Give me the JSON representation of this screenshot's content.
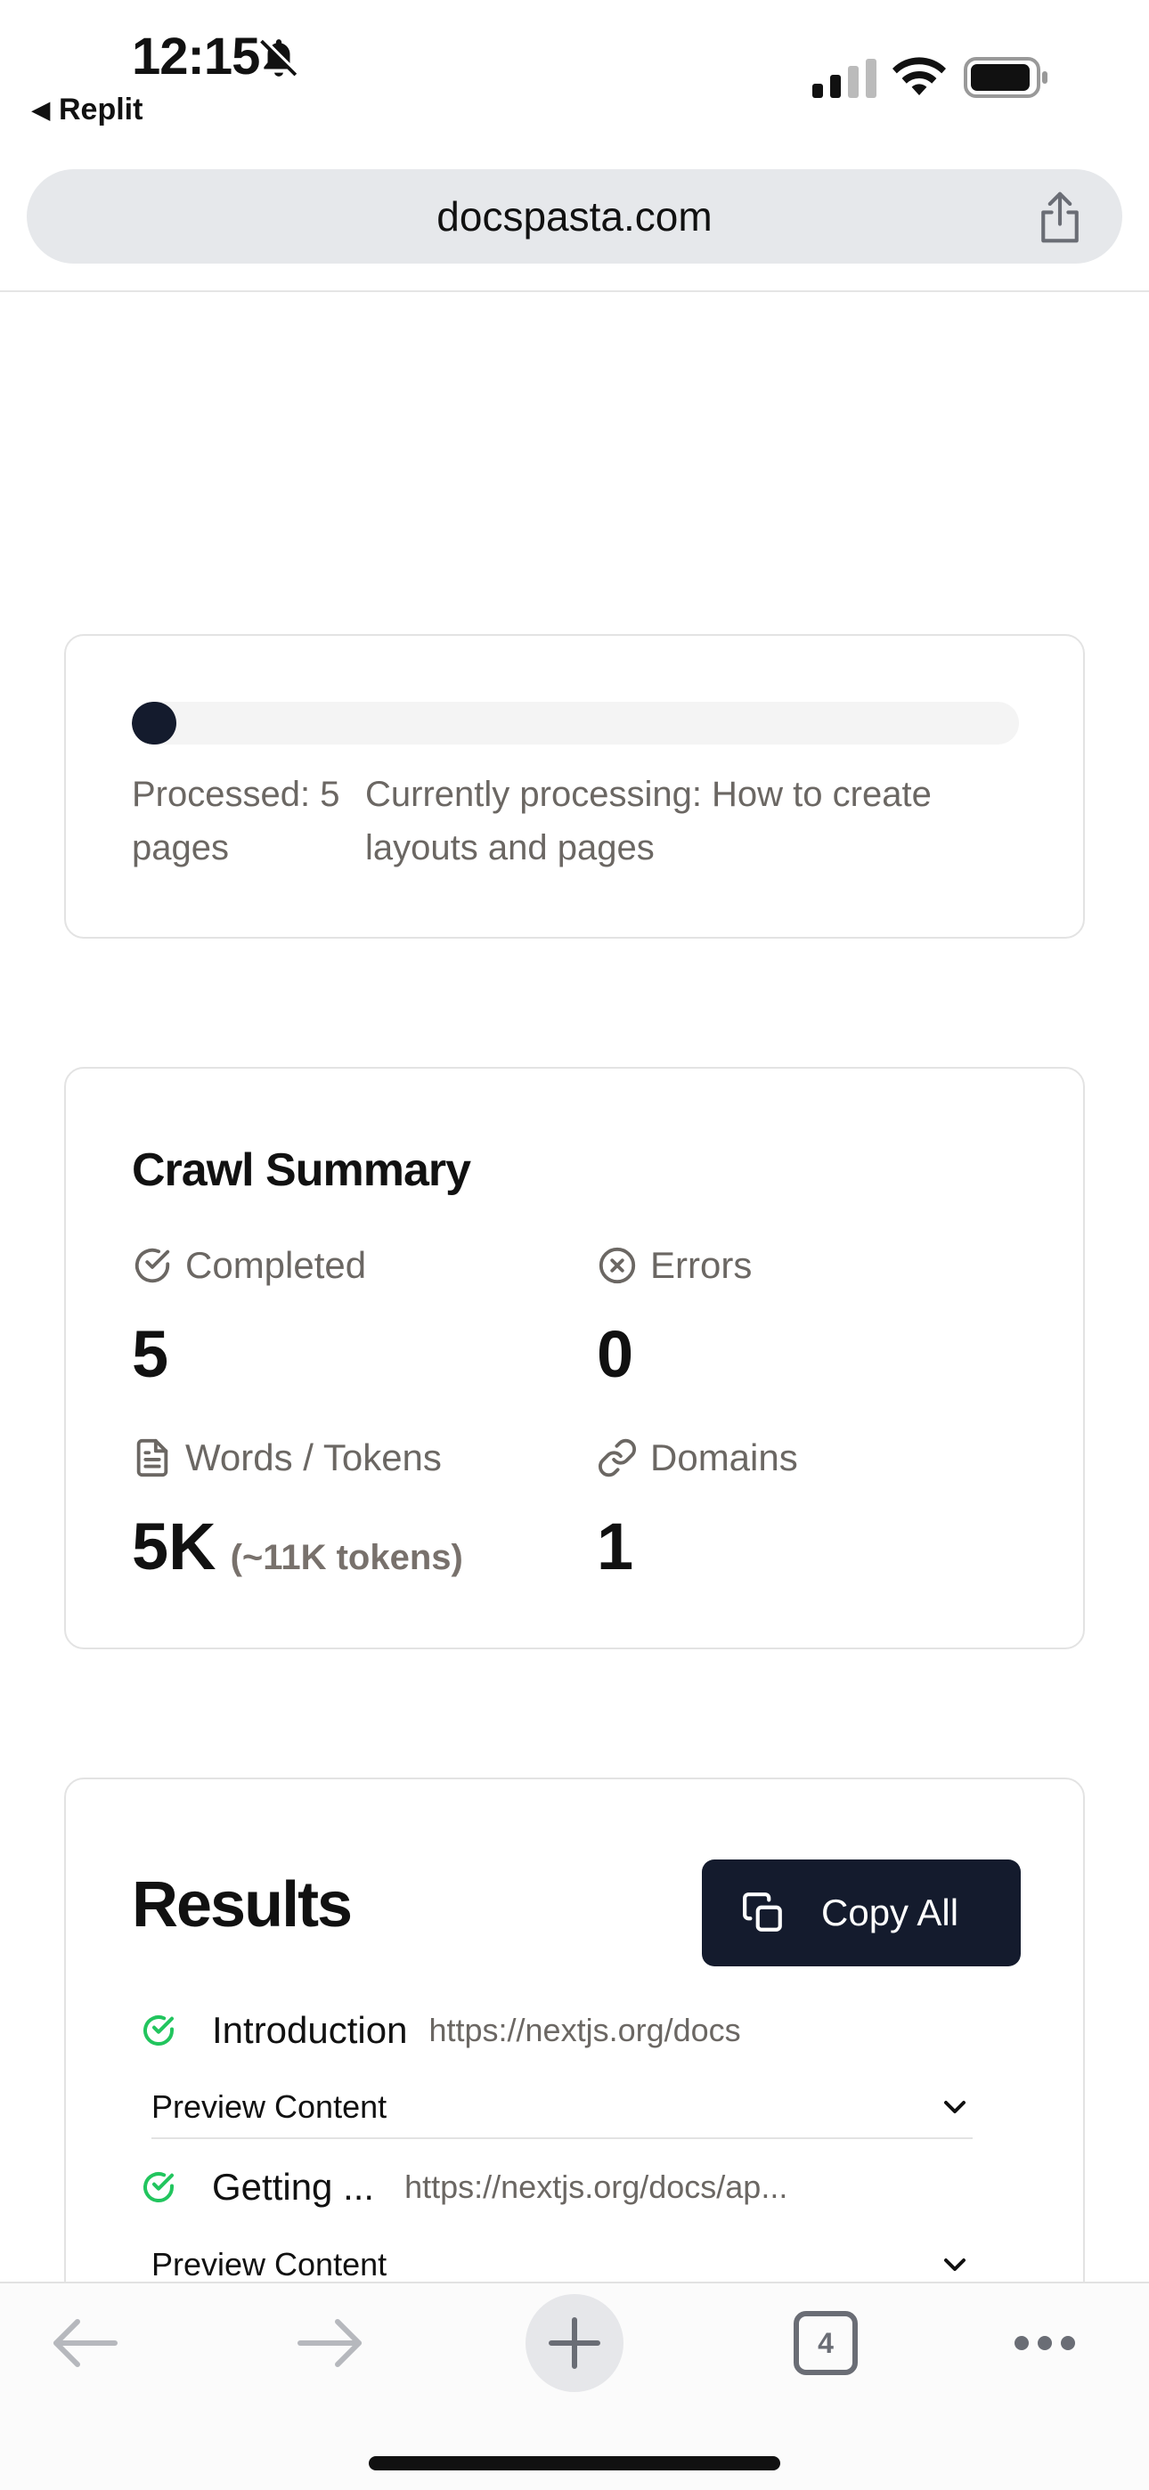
{
  "status_bar": {
    "time": "12:15",
    "back_app": "Replit",
    "icons": [
      "bell-slash-icon",
      "cellular-signal-icon",
      "wifi-icon",
      "battery-icon"
    ]
  },
  "browser": {
    "url": "docspasta.com",
    "share_icon": "share-icon"
  },
  "progress": {
    "fraction": 0.05,
    "processed_text": "Processed: 5 pages",
    "current_text": "Currently processing: How to create layouts and pages"
  },
  "summary": {
    "title": "Crawl Summary",
    "stats": [
      {
        "label": "Completed",
        "value": "5",
        "icon": "check-circle-icon"
      },
      {
        "label": "Errors",
        "value": "0",
        "icon": "x-circle-icon"
      },
      {
        "label": "Words / Tokens",
        "value": "5K",
        "sub": "(~11K tokens)",
        "icon": "document-icon"
      },
      {
        "label": "Domains",
        "value": "1",
        "icon": "link-icon"
      }
    ]
  },
  "results": {
    "title": "Results",
    "copy_all_label": "Copy All",
    "items": [
      {
        "title": "Introduction",
        "url": "https://nextjs.org/docs",
        "preview_label": "Preview Content",
        "status": "success"
      },
      {
        "title": "Getting ...",
        "url": "https://nextjs.org/docs/ap...",
        "preview_label": "Preview Content",
        "status": "success"
      }
    ]
  },
  "toolbar": {
    "tab_count": "4",
    "icons": [
      "back-arrow-icon",
      "forward-arrow-icon",
      "plus-icon",
      "tabs-icon",
      "more-icon"
    ]
  },
  "colors": {
    "accent_dark": "#141b2d",
    "muted_text": "#6b6763",
    "success": "#22c55e"
  }
}
